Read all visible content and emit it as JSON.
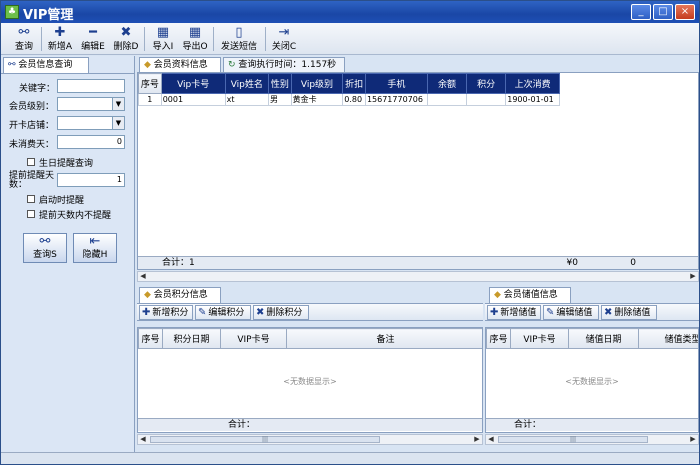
{
  "window": {
    "title": "VIP管理"
  },
  "toolbar": {
    "query": "查询",
    "add": "新增A",
    "edit": "编辑E",
    "delete": "删除D",
    "import": "导入I",
    "export": "导出O",
    "sms": "发送短信",
    "close": "关闭C"
  },
  "left": {
    "tab": "会员信息查询",
    "keyword_label": "关键字：",
    "keyword_value": "",
    "level_label": "会员级别：",
    "level_value": "",
    "store_label": "开卡店铺：",
    "store_value": "",
    "days_label": "未消费天：",
    "days_value": "0",
    "birthday": "生日提醒查询",
    "advance_label": "提前提醒天数：",
    "advance_value": "1",
    "startup": "启动时提醒",
    "no_remind": "提前天数内不提醒",
    "query_btn": "查询S",
    "hide_btn": "隐藏H"
  },
  "main": {
    "tab_info": "会员资料信息",
    "tab_time": "查询执行时间：1.157秒",
    "columns": [
      "序号",
      "Vip卡号",
      "Vip姓名",
      "性别",
      "Vip级别",
      "折扣",
      "手机",
      "余额",
      "积分",
      "上次消费"
    ],
    "rows": [
      [
        "1",
        "0001",
        "xt",
        "男",
        "黄金卡",
        "0.80",
        "15671770706",
        "",
        "",
        "1900-01-01"
      ]
    ],
    "total_label": "合计：1",
    "total_balance": "¥0",
    "total_points": "0"
  },
  "points": {
    "tab": "会员积分信息",
    "add": "新增积分",
    "edit": "编辑积分",
    "delete": "删除积分",
    "columns": [
      "序号",
      "积分日期",
      "VIP卡号",
      "备注"
    ],
    "empty": "<无数据显示>",
    "total_label": "合计："
  },
  "stored": {
    "tab": "会员储值信息",
    "add": "新增储值",
    "edit": "编辑储值",
    "delete": "删除储值",
    "columns": [
      "序号",
      "VIP卡号",
      "储值日期",
      "储值类型"
    ],
    "empty": "<无数据显示>",
    "total_label": "合计："
  },
  "colors": {
    "header_dark": "#0f2a78",
    "title_blue": "#1a47a6",
    "panel": "#dbe6f5"
  }
}
